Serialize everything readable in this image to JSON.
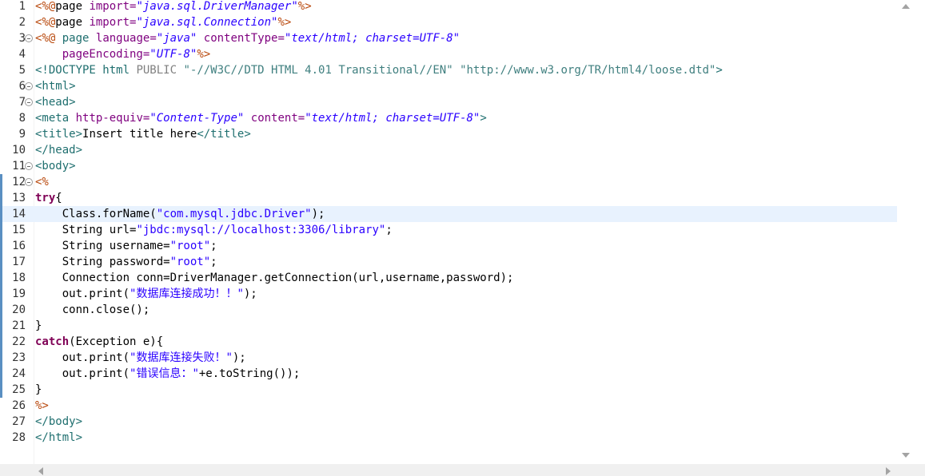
{
  "editor": {
    "current_line": 14,
    "fold_lines": [
      3,
      6,
      7,
      11,
      12
    ],
    "changed_lines": [
      12,
      13,
      14,
      15,
      16,
      17,
      18,
      19,
      20,
      21,
      22,
      23,
      24,
      25
    ],
    "lines": [
      {
        "n": "1",
        "tokens": [
          [
            "jsp",
            "<%@"
          ],
          [
            "plain",
            "page "
          ],
          [
            "attr",
            "import="
          ],
          [
            "attrval",
            "\"java.sql.DriverManager\""
          ],
          [
            "jsp",
            "%>"
          ]
        ]
      },
      {
        "n": "2",
        "tokens": [
          [
            "jsp",
            "<%@"
          ],
          [
            "plain",
            "page "
          ],
          [
            "attr",
            "import="
          ],
          [
            "attrval",
            "\"java.sql.Connection\""
          ],
          [
            "jsp",
            "%>"
          ]
        ]
      },
      {
        "n": "3",
        "tokens": [
          [
            "jsp",
            "<%@"
          ],
          [
            "plain",
            " "
          ],
          [
            "tag",
            "page"
          ],
          [
            "plain",
            " "
          ],
          [
            "attr",
            "language="
          ],
          [
            "attrval",
            "\"java\""
          ],
          [
            "plain",
            " "
          ],
          [
            "attr",
            "contentType="
          ],
          [
            "attrval",
            "\"text/html; charset=UTF-8\""
          ]
        ]
      },
      {
        "n": "4",
        "tokens": [
          [
            "plain",
            "    "
          ],
          [
            "attr",
            "pageEncoding="
          ],
          [
            "attrval",
            "\"UTF-8\""
          ],
          [
            "jsp",
            "%>"
          ]
        ]
      },
      {
        "n": "5",
        "tokens": [
          [
            "tag",
            "<!DOCTYPE"
          ],
          [
            "plain",
            " "
          ],
          [
            "tag",
            "html"
          ],
          [
            "plain",
            " "
          ],
          [
            "docpub",
            "PUBLIC"
          ],
          [
            "plain",
            " "
          ],
          [
            "doc",
            "\"-//W3C//DTD HTML 4.01 Transitional//EN\""
          ],
          [
            "plain",
            " "
          ],
          [
            "doc",
            "\"http://www.w3.org/TR/html4/loose.dtd\""
          ],
          [
            "tag",
            ">"
          ]
        ]
      },
      {
        "n": "6",
        "tokens": [
          [
            "tag",
            "<html>"
          ]
        ]
      },
      {
        "n": "7",
        "tokens": [
          [
            "tag",
            "<head>"
          ]
        ]
      },
      {
        "n": "8",
        "tokens": [
          [
            "tag",
            "<meta"
          ],
          [
            "plain",
            " "
          ],
          [
            "attr",
            "http-equiv="
          ],
          [
            "attrval",
            "\"Content-Type\""
          ],
          [
            "plain",
            " "
          ],
          [
            "attr",
            "content="
          ],
          [
            "attrval",
            "\"text/html; charset=UTF-8\""
          ],
          [
            "tag",
            ">"
          ]
        ]
      },
      {
        "n": "9",
        "tokens": [
          [
            "tag",
            "<title>"
          ],
          [
            "plain",
            "Insert title here"
          ],
          [
            "tag",
            "</title>"
          ]
        ]
      },
      {
        "n": "10",
        "tokens": [
          [
            "tag",
            "</head>"
          ]
        ]
      },
      {
        "n": "11",
        "tokens": [
          [
            "tag",
            "<body>"
          ]
        ]
      },
      {
        "n": "12",
        "tokens": [
          [
            "jsp",
            "<%"
          ]
        ]
      },
      {
        "n": "13",
        "tokens": [
          [
            "kw",
            "try"
          ],
          [
            "plain",
            "{"
          ]
        ]
      },
      {
        "n": "14",
        "tokens": [
          [
            "plain",
            "    Class.forName("
          ],
          [
            "str",
            "\"com.mysql.jdbc.Driver\""
          ],
          [
            "plain",
            ");"
          ]
        ]
      },
      {
        "n": "15",
        "tokens": [
          [
            "plain",
            "    String url="
          ],
          [
            "str",
            "\"jbdc:mysql://localhost:3306/library\""
          ],
          [
            "plain",
            ";"
          ]
        ]
      },
      {
        "n": "16",
        "tokens": [
          [
            "plain",
            "    String username="
          ],
          [
            "str",
            "\"root\""
          ],
          [
            "plain",
            ";"
          ]
        ]
      },
      {
        "n": "17",
        "tokens": [
          [
            "plain",
            "    String password="
          ],
          [
            "str",
            "\"root\""
          ],
          [
            "plain",
            ";"
          ]
        ]
      },
      {
        "n": "18",
        "tokens": [
          [
            "plain",
            "    Connection conn=DriverManager.getConnection(url,username,password);"
          ]
        ]
      },
      {
        "n": "19",
        "tokens": [
          [
            "plain",
            "    out.print("
          ],
          [
            "str",
            "\"数据库连接成功！！\""
          ],
          [
            "plain",
            ");"
          ]
        ]
      },
      {
        "n": "20",
        "tokens": [
          [
            "plain",
            "    conn.close();"
          ]
        ]
      },
      {
        "n": "21",
        "tokens": [
          [
            "plain",
            "}"
          ]
        ]
      },
      {
        "n": "22",
        "tokens": [
          [
            "kw",
            "catch"
          ],
          [
            "plain",
            "(Exception e){"
          ]
        ]
      },
      {
        "n": "23",
        "tokens": [
          [
            "plain",
            "    out.print("
          ],
          [
            "str",
            "\"数据库连接失败！\""
          ],
          [
            "plain",
            ");"
          ]
        ]
      },
      {
        "n": "24",
        "tokens": [
          [
            "plain",
            "    out.print("
          ],
          [
            "str",
            "\"错误信息：\""
          ],
          [
            "plain",
            "+e.toString());"
          ]
        ]
      },
      {
        "n": "25",
        "tokens": [
          [
            "plain",
            "}"
          ]
        ]
      },
      {
        "n": "26",
        "tokens": [
          [
            "jsp",
            "%>"
          ]
        ]
      },
      {
        "n": "27",
        "tokens": [
          [
            "tag",
            "</body>"
          ]
        ]
      },
      {
        "n": "28",
        "tokens": [
          [
            "tag",
            "</html>"
          ]
        ]
      }
    ]
  }
}
